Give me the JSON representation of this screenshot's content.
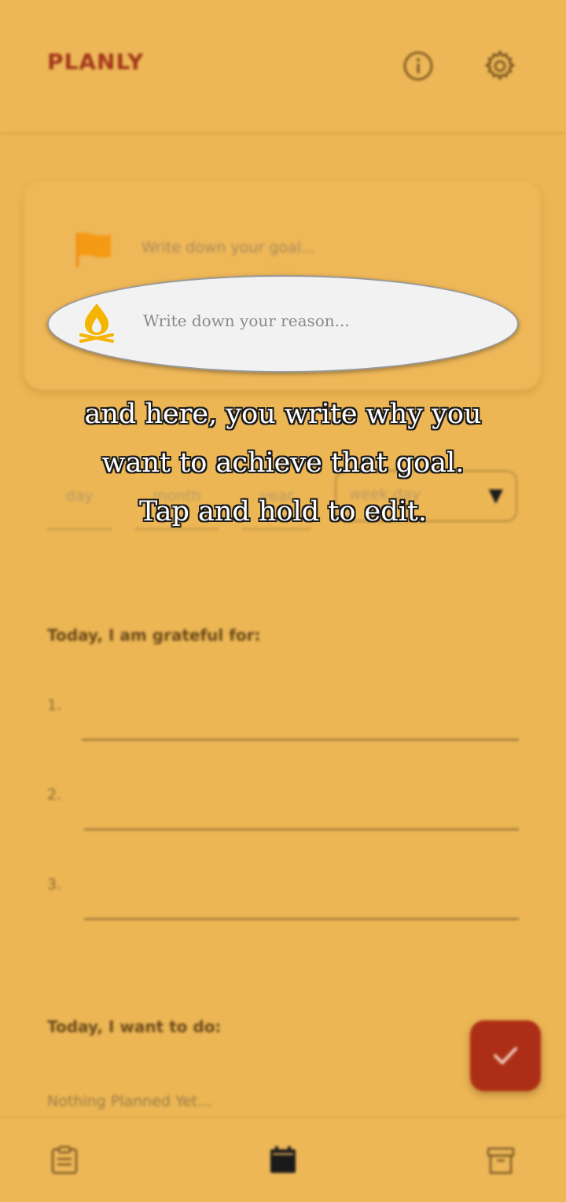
{
  "app": {
    "title": "PLANLY"
  },
  "header": {
    "info_icon": "info-icon",
    "settings_icon": "gear-icon"
  },
  "goal_card": {
    "goal_placeholder": "Write down your goal...",
    "reason_placeholder": "Write down your reason...",
    "flag_icon": "flag-icon",
    "reason_icon": "campfire-icon"
  },
  "date": {
    "day_placeholder": "day",
    "month_placeholder": "month",
    "year_placeholder": "year",
    "weekday_placeholder": "week day"
  },
  "gratitude": {
    "heading": "Today, I am grateful for:",
    "items": [
      "1.",
      "2.",
      "3."
    ]
  },
  "todo": {
    "heading": "Today, I want to do:",
    "empty_text": "Nothing Planned Yet..."
  },
  "tutorial": {
    "lines": [
      "and here, you write why you",
      "want to achieve that goal.",
      "Tap and hold to edit."
    ]
  },
  "bottom_nav": {
    "tasks_icon": "clipboard-icon",
    "calendar_icon": "calendar-icon",
    "archive_icon": "archive-icon"
  },
  "colors": {
    "background": "#ecb655",
    "accent": "#ad2e16",
    "brand_title": "#a3361a",
    "highlight": "#f2f2f2",
    "icon_yellow": "#f4b400"
  }
}
